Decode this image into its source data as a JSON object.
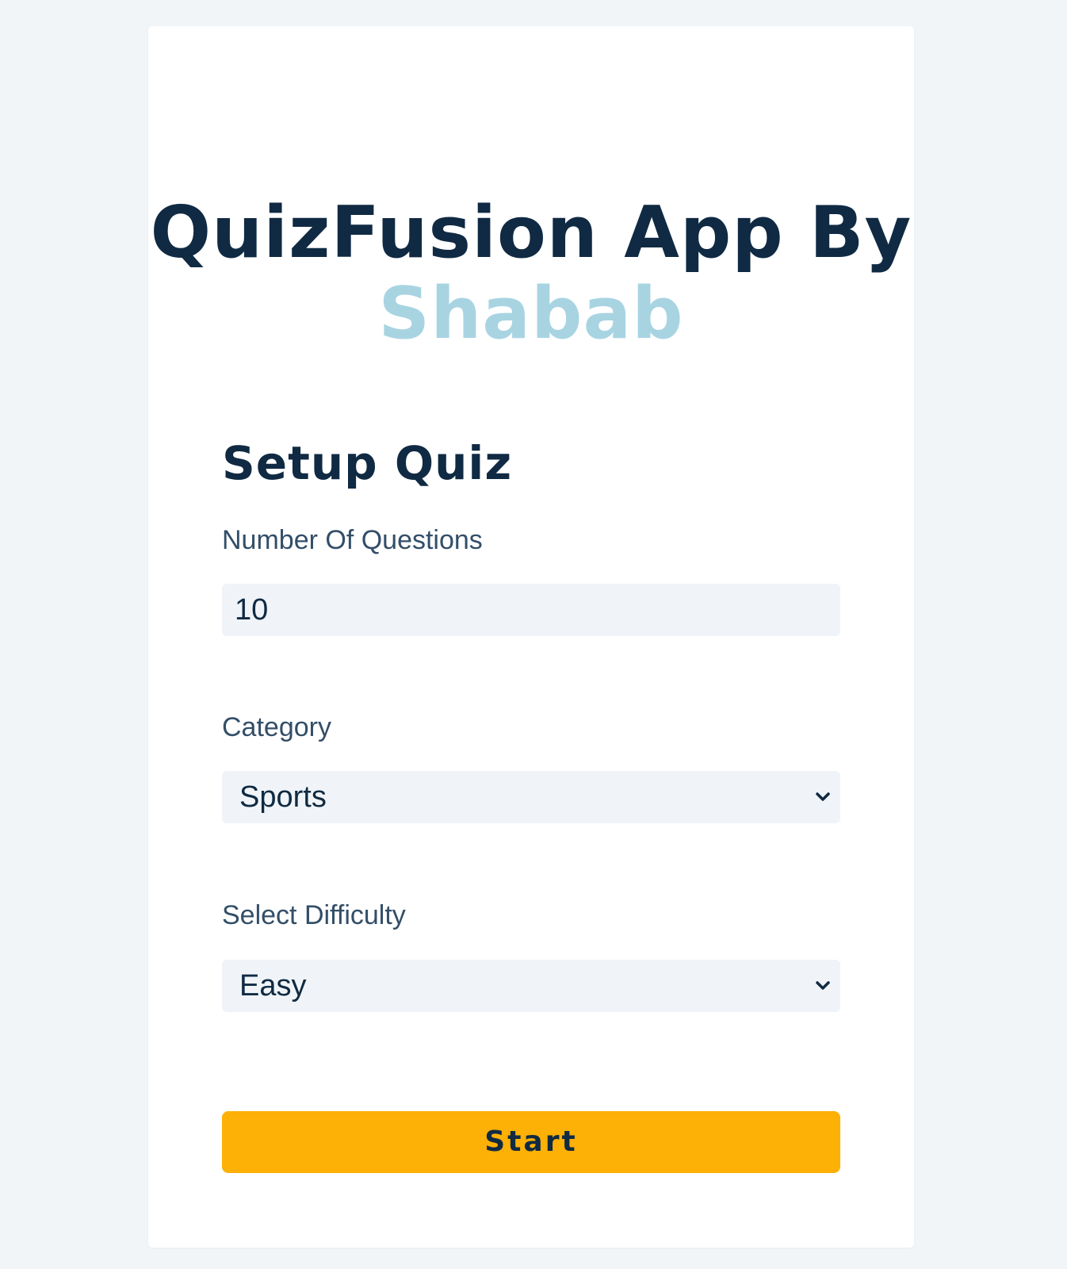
{
  "app": {
    "title_main": "QuizFusion App By",
    "title_accent": "Shabab"
  },
  "setup": {
    "heading": "Setup Quiz",
    "questions": {
      "label": "Number Of Questions",
      "value": "10"
    },
    "category": {
      "label": "Category",
      "selected": "Sports"
    },
    "difficulty": {
      "label": "Select Difficulty",
      "selected": "Easy"
    },
    "start_label": "Start"
  },
  "icons": {
    "select_arrow": "chevron-down-icon"
  },
  "colors": {
    "page_background": "#f1f5f8",
    "card_background": "#ffffff",
    "title_dark": "#102a43",
    "title_accent": "#a8d4e2",
    "field_background": "#f0f4f8",
    "button": "#fdb005"
  }
}
